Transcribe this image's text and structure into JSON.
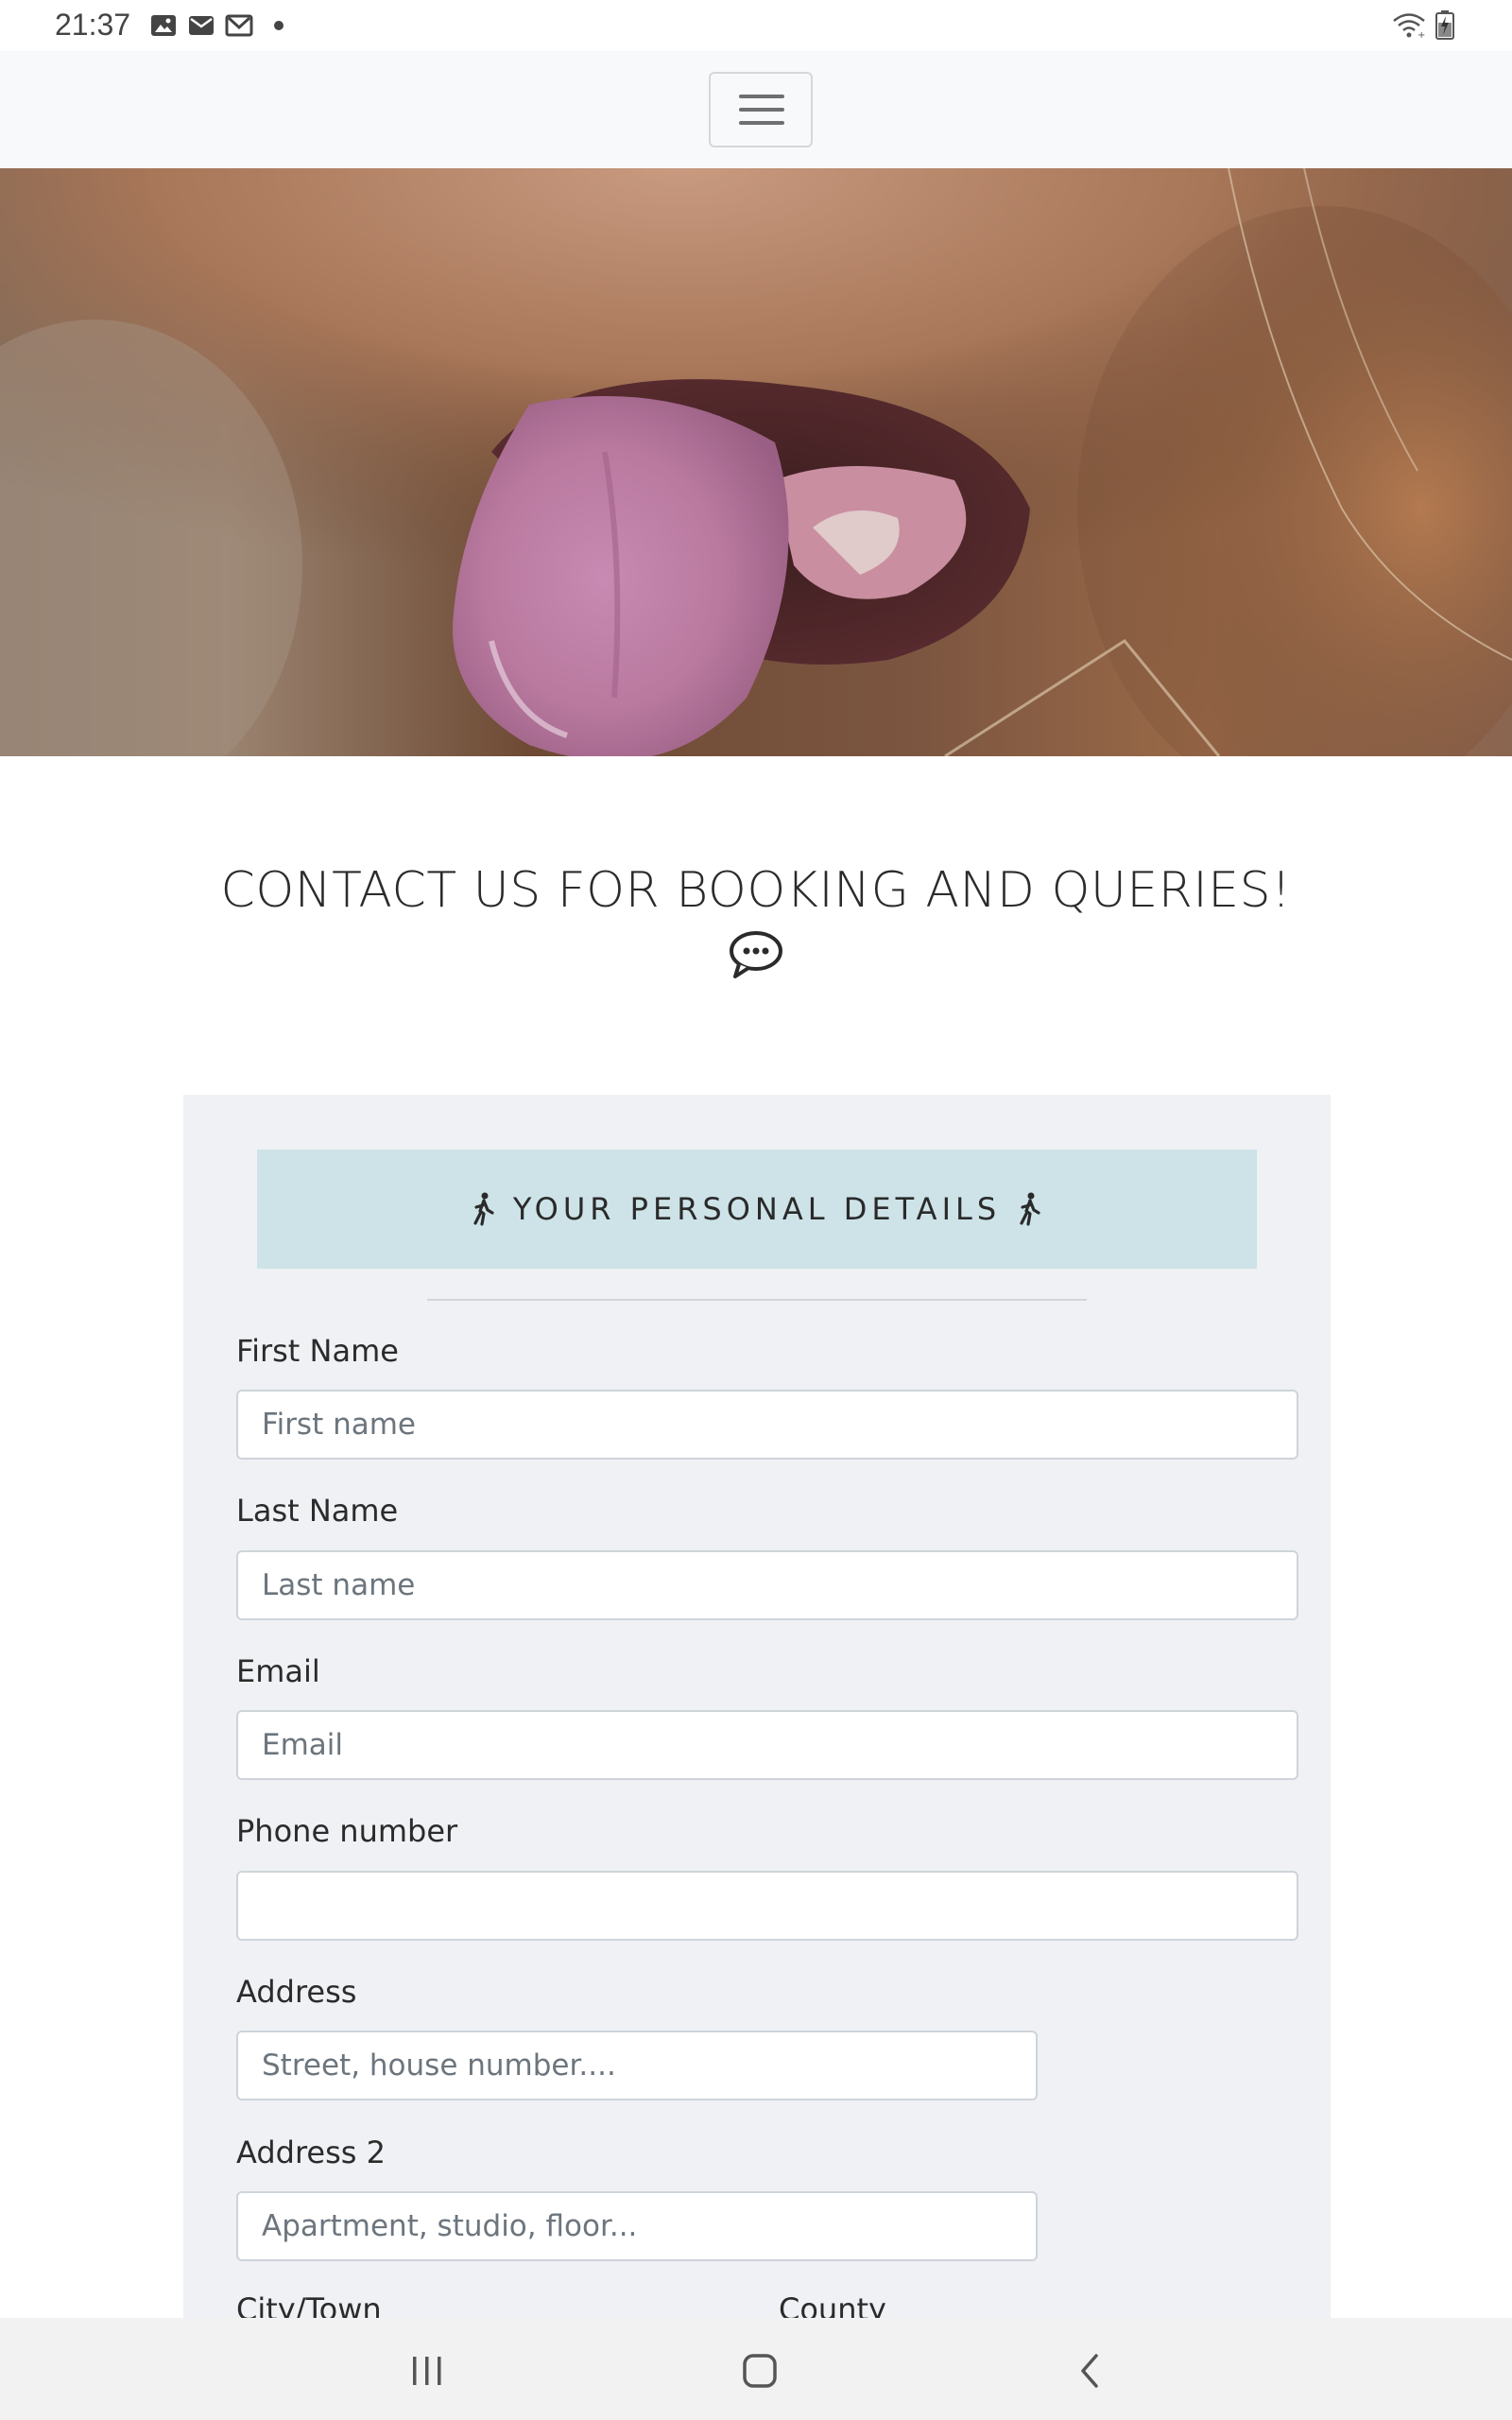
{
  "status_bar": {
    "time": "21:37",
    "icons_left": [
      "image-icon",
      "mail-icon",
      "gmail-icon",
      "notification-dot-icon"
    ],
    "icons_right": [
      "wifi-icon",
      "battery-charging-icon"
    ]
  },
  "navbar": {
    "toggler_icon": "hamburger-menu-icon"
  },
  "hero": {
    "image": "dog-tongue-photo"
  },
  "contact": {
    "heading": "CONTACT US FOR BOOKING AND QUERIES!",
    "icon": "chat-bubble-icon"
  },
  "form": {
    "section_title": "YOUR PERSONAL DETAILS",
    "section_icon": "walking-person-icon",
    "fields": {
      "first_name": {
        "label": "First Name",
        "placeholder": "First name",
        "value": ""
      },
      "last_name": {
        "label": "Last Name",
        "placeholder": "Last name",
        "value": ""
      },
      "email": {
        "label": "Email",
        "placeholder": "Email",
        "value": ""
      },
      "phone": {
        "label": "Phone number",
        "placeholder": "",
        "value": ""
      },
      "address": {
        "label": "Address",
        "placeholder": "Street, house number....",
        "value": ""
      },
      "address2": {
        "label": "Address 2",
        "placeholder": "Apartment, studio, floor...",
        "value": ""
      },
      "city": {
        "label": "City/Town"
      },
      "county": {
        "label": "County"
      }
    }
  },
  "android_nav": {
    "buttons": [
      "recent-apps-icon",
      "home-icon",
      "back-icon"
    ]
  },
  "colors": {
    "navbar_bg": "#f8f9fa",
    "form_bg": "#eff1f4",
    "banner_bg": "#cde3e8",
    "input_border": "#ced4da"
  }
}
